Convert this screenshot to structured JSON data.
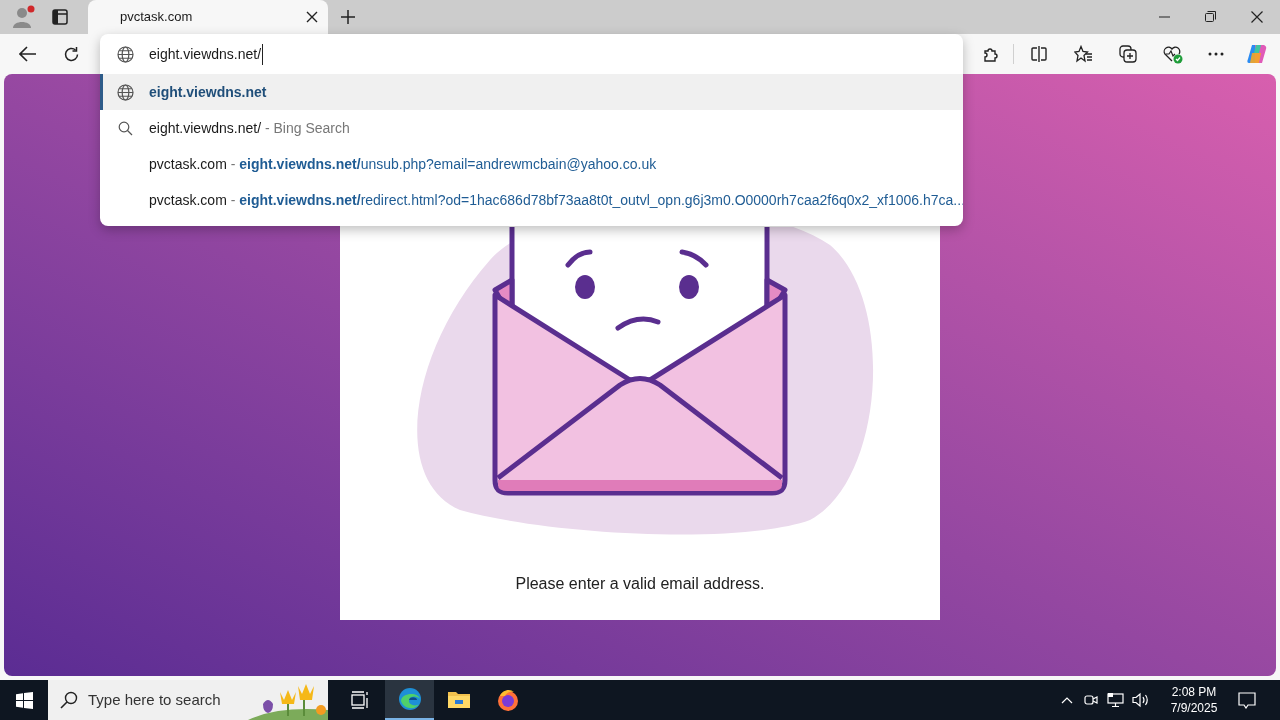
{
  "tab": {
    "title": "pvctask.com",
    "selected": true
  },
  "address_bar": {
    "value": "eight.viewdns.net/"
  },
  "suggestions": [
    {
      "kind": "url",
      "selected": true,
      "text": "eight.viewdns.net"
    },
    {
      "kind": "search",
      "selected": false,
      "query": "eight.viewdns.net/",
      "suffix": "- Bing Search"
    },
    {
      "kind": "history",
      "selected": false,
      "site": "pvctask.com",
      "separator": "-",
      "host": "eight.viewdns.net/",
      "path": "unsub.php?email=andrewmcbain@yahoo.co.uk"
    },
    {
      "kind": "history",
      "selected": false,
      "site": "pvctask.com",
      "separator": "-",
      "host": "eight.viewdns.net/",
      "path": "redirect.html?od=1hac686d78bf73aa8t0t_outvl_opn.g6j3m0.O0000rh7caa2f6q0x2_xf1006.h7ca..."
    }
  ],
  "page": {
    "message": "Please enter a valid email address."
  },
  "taskbar": {
    "search_placeholder": "Type here to search",
    "apps": [
      {
        "kind": "task-view",
        "selected": false
      },
      {
        "kind": "edge",
        "selected": true
      },
      {
        "kind": "explorer",
        "selected": false
      },
      {
        "kind": "firefox",
        "selected": false
      }
    ],
    "time": "2:08 PM",
    "date": "7/9/2025"
  }
}
